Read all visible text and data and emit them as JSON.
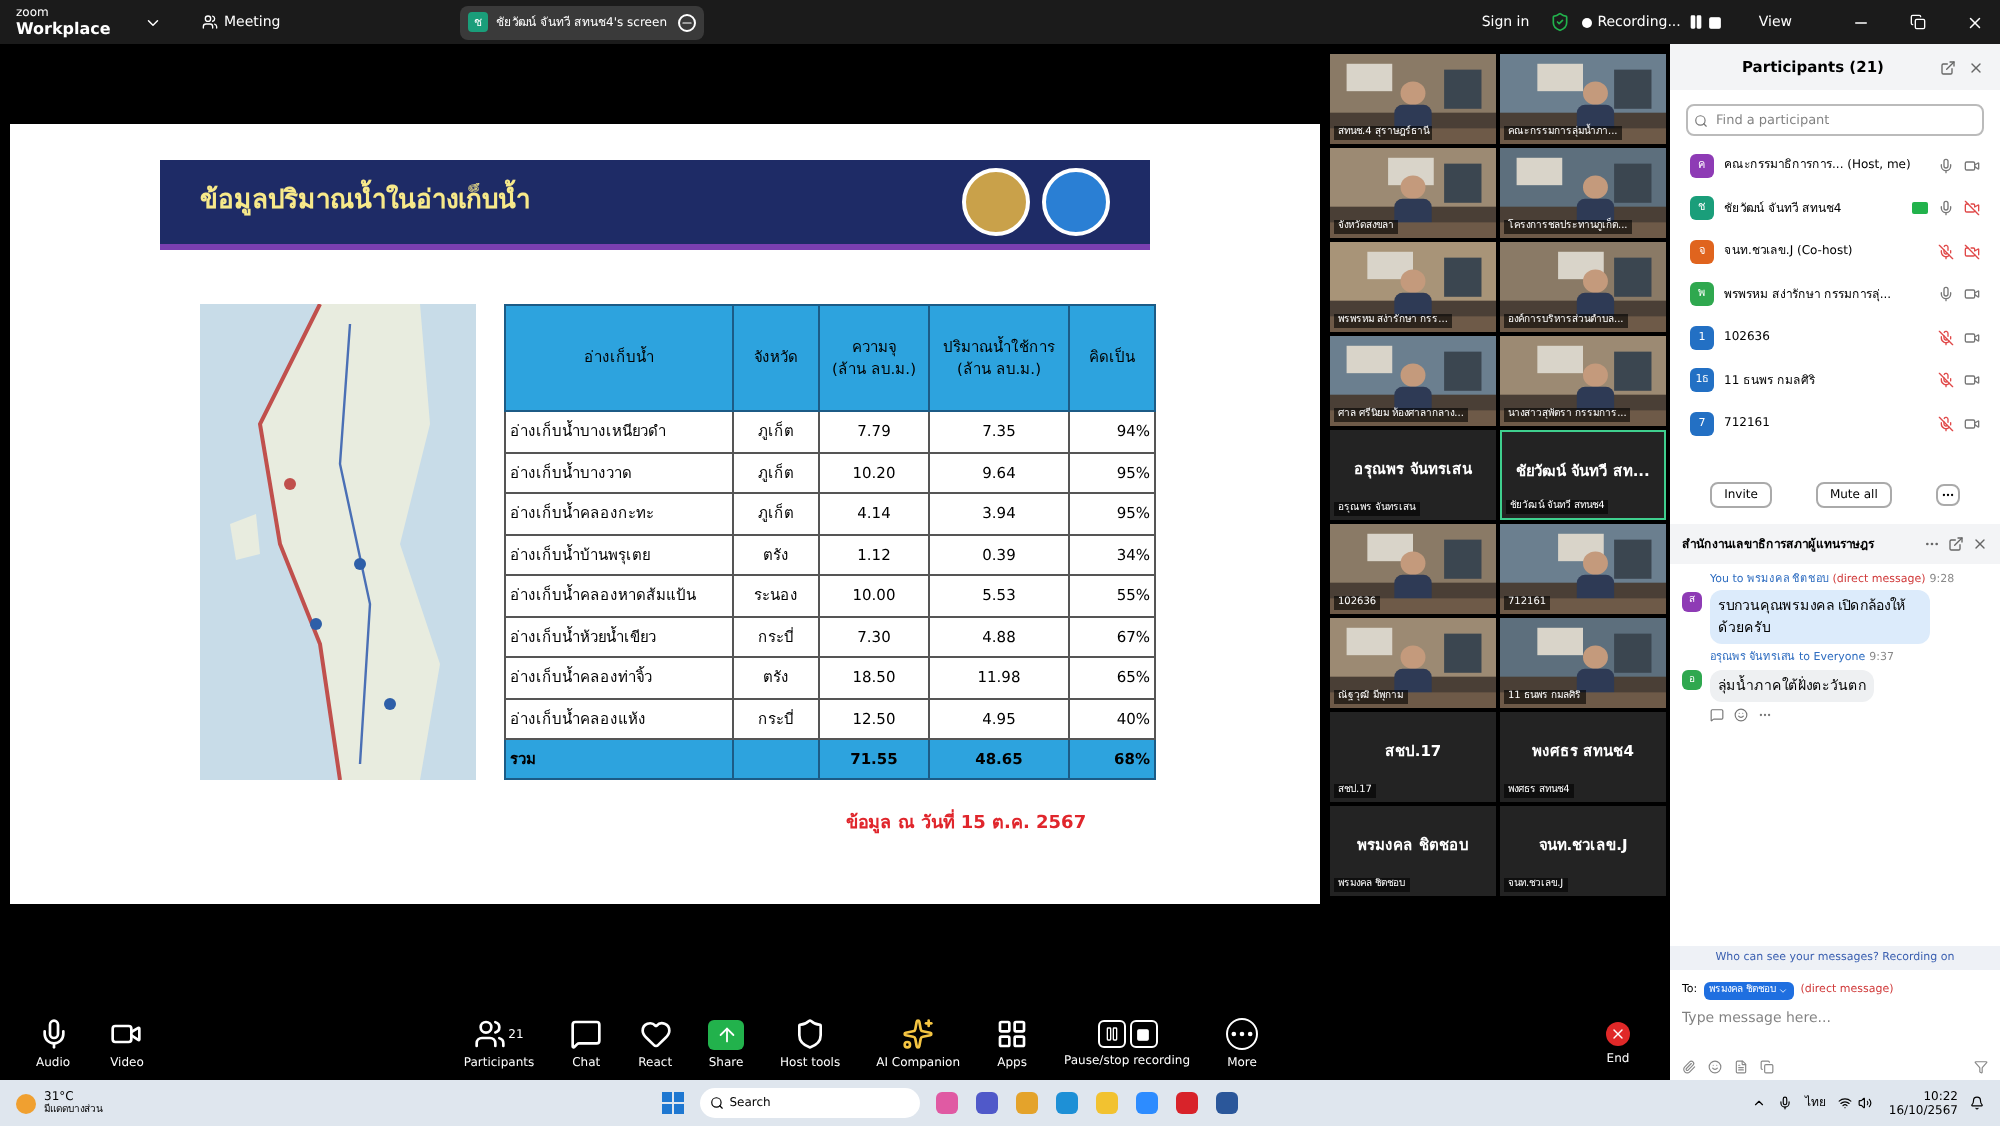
{
  "top_bar": {
    "brand_top": "zoom",
    "brand_bottom": "Workplace",
    "meeting": "Meeting",
    "share_pill": {
      "initial": "ช",
      "label": "ชัยวัฒน์ จันทวี สทนช4's screen"
    },
    "sign_in": "Sign in",
    "recording": "Recording...",
    "view": "View"
  },
  "slide": {
    "title": "ข้อมูลปริมาณน้ำในอ่างเก็บน้ำ",
    "table": {
      "columns": [
        "อ่างเก็บน้ำ",
        "จังหวัด",
        "ความจุ\n(ล้าน ลบ.ม.)",
        "ปริมาณน้ำใช้การ\n(ล้าน ลบ.ม.)",
        "คิดเป็น"
      ],
      "rows": [
        [
          "อ่างเก็บน้ำบางเหนียวดำ",
          "ภูเก็ต",
          "7.79",
          "7.35",
          "94%"
        ],
        [
          "อ่างเก็บน้ำบางวาด",
          "ภูเก็ต",
          "10.20",
          "9.64",
          "95%"
        ],
        [
          "อ่างเก็บน้ำคลองกะทะ",
          "ภูเก็ต",
          "4.14",
          "3.94",
          "95%"
        ],
        [
          "อ่างเก็บน้ำบ้านพรุเตย",
          "ตรัง",
          "1.12",
          "0.39",
          "34%"
        ],
        [
          "อ่างเก็บน้ำคลองหาดส้มแป้น",
          "ระนอง",
          "10.00",
          "5.53",
          "55%"
        ],
        [
          "อ่างเก็บน้ำห้วยน้ำเขียว",
          "กระบี่",
          "7.30",
          "4.88",
          "67%"
        ],
        [
          "อ่างเก็บน้ำคลองท่าจิ้ว",
          "ตรัง",
          "18.50",
          "11.98",
          "65%"
        ],
        [
          "อ่างเก็บน้ำคลองแห้ง",
          "กระบี่",
          "12.50",
          "4.95",
          "40%"
        ]
      ],
      "total": {
        "label": "รวม",
        "capacity": "71.55",
        "usable": "48.65",
        "percent": "68%"
      }
    },
    "footnote": "ข้อมูล ณ วันที่ 15 ต.ค. 2567"
  },
  "video_tiles": [
    {
      "kind": "video",
      "label": "สทนช.4 สุราษฎร์ธานี",
      "selected": false
    },
    {
      "kind": "video",
      "label": "คณะกรรมการลุ่มน้ำภา...",
      "selected": false
    },
    {
      "kind": "video",
      "label": "จังหวัดสงขลา",
      "selected": false
    },
    {
      "kind": "video",
      "label": "โครงการชลประทานภูเก็ต...",
      "selected": false
    },
    {
      "kind": "video",
      "label": "พรพรหม สง่ารักษา กรร...",
      "selected": false
    },
    {
      "kind": "video",
      "label": "องค์การบริหารส่วนตำบล...",
      "selected": false
    },
    {
      "kind": "video",
      "label": "ศาล ศรีนิยม ห้องศาลากลาง...",
      "selected": false
    },
    {
      "kind": "video",
      "label": "นางสาวสุพัตรา กรรมการ...",
      "selected": false
    },
    {
      "kind": "name",
      "name": "อรุณพร จันทรเสน",
      "label": "อรุณพร จันทรเสน",
      "selected": false
    },
    {
      "kind": "name",
      "name": "ชัยวัฒน์ จันทวี สท...",
      "label": "ชัยวัฒน์ จันทวี สทนช4",
      "selected": true
    },
    {
      "kind": "video",
      "label": "102636",
      "selected": false
    },
    {
      "kind": "video",
      "label": "712161",
      "selected": false
    },
    {
      "kind": "video",
      "label": "ณัฐวุฒิ มีพุกาม",
      "selected": false
    },
    {
      "kind": "video",
      "label": "11 ธนพร กมลศิริ",
      "selected": false
    },
    {
      "kind": "name",
      "name": "สชป.17",
      "label": "สชป.17",
      "selected": false
    },
    {
      "kind": "name",
      "name": "พงศธร สทนช4",
      "label": "พงศธร สทนช4",
      "selected": false
    },
    {
      "kind": "name",
      "name": "พรมงคล ชิตชอบ",
      "label": "พรมงคล ชิตชอบ",
      "selected": false
    },
    {
      "kind": "name",
      "name": "จนท.ชวเลข.J",
      "label": "จนท.ชวเลข.J",
      "selected": false
    }
  ],
  "participants": {
    "title": "Participants (21)",
    "search_placeholder": "Find a participant",
    "items": [
      {
        "initial": "ค",
        "color": "#8e3bb5",
        "name": "คณะกรรมาธิการการ... (Host, me)",
        "sharing": false,
        "mic_muted": false,
        "video_muted": false
      },
      {
        "initial": "ช",
        "color": "#1a9e7a",
        "name": "ชัยวัฒน์ จันทวี สทนช4",
        "sharing": true,
        "mic_muted": false,
        "video_muted": true
      },
      {
        "initial": "จ",
        "color": "#e0641e",
        "name": "จนท.ชวเลข.J (Co-host)",
        "sharing": false,
        "mic_muted": true,
        "video_muted": true
      },
      {
        "initial": "พ",
        "color": "#2fa84f",
        "name": "พรพรหม สง่ารักษา กรรมการลุ่...",
        "sharing": false,
        "mic_muted": false,
        "video_muted": false
      },
      {
        "initial": "1",
        "color": "#2370c4",
        "name": "102636",
        "sharing": false,
        "mic_muted": true,
        "video_muted": false
      },
      {
        "initial": "1ธ",
        "color": "#2370c4",
        "name": "11 ธนพร กมลศิริ",
        "sharing": false,
        "mic_muted": true,
        "video_muted": false
      },
      {
        "initial": "7",
        "color": "#2370c4",
        "name": "712161",
        "sharing": false,
        "mic_muted": true,
        "video_muted": false
      }
    ],
    "buttons": [
      "Invite",
      "Mute all"
    ]
  },
  "chat": {
    "title": "สำนักงานเลขาธิการสภาผู้แทนราษฎร",
    "messages": [
      {
        "initial": "ส",
        "color": "#8e3bb5",
        "sender": "You to พรมงคล ชิตชอบ",
        "note": "(direct message)",
        "time": "9:28",
        "text": "รบกวนคุณพรมงคล เปิดกล้องให้ด้วยครับ",
        "own": true
      },
      {
        "initial": "อ",
        "color": "#2fa84f",
        "sender": "อรุณพร จันทรเสน to Everyone",
        "time": "9:37",
        "text": "ลุ่มน้ำภาคใต้ฝั่งตะวันตก",
        "own": false
      }
    ],
    "notice": "Who can see your messages? Recording on",
    "to_label": "To:",
    "recipient": "พรมงคล ชิตชอบ",
    "recipient_note": "(direct message)",
    "placeholder": "Type message here..."
  },
  "toolbar": [
    {
      "kind": "audio",
      "label": "Audio"
    },
    {
      "kind": "video",
      "label": "Video"
    },
    {
      "kind": "participants",
      "label": "Participants",
      "count": "21"
    },
    {
      "kind": "chat",
      "label": "Chat"
    },
    {
      "kind": "react",
      "label": "React"
    },
    {
      "kind": "share",
      "label": "Share"
    },
    {
      "kind": "host",
      "label": "Host tools"
    },
    {
      "kind": "ai",
      "label": "AI Companion"
    },
    {
      "kind": "apps",
      "label": "Apps"
    },
    {
      "kind": "record",
      "label": "Pause/stop recording"
    },
    {
      "kind": "more",
      "label": "More"
    }
  ],
  "end_label": "End",
  "taskbar": {
    "temperature": "31°C",
    "weather": "มีแดดบางส่วน",
    "search": "Search",
    "language": "ไทย",
    "time": "10:22",
    "date": "16/10/2567"
  }
}
